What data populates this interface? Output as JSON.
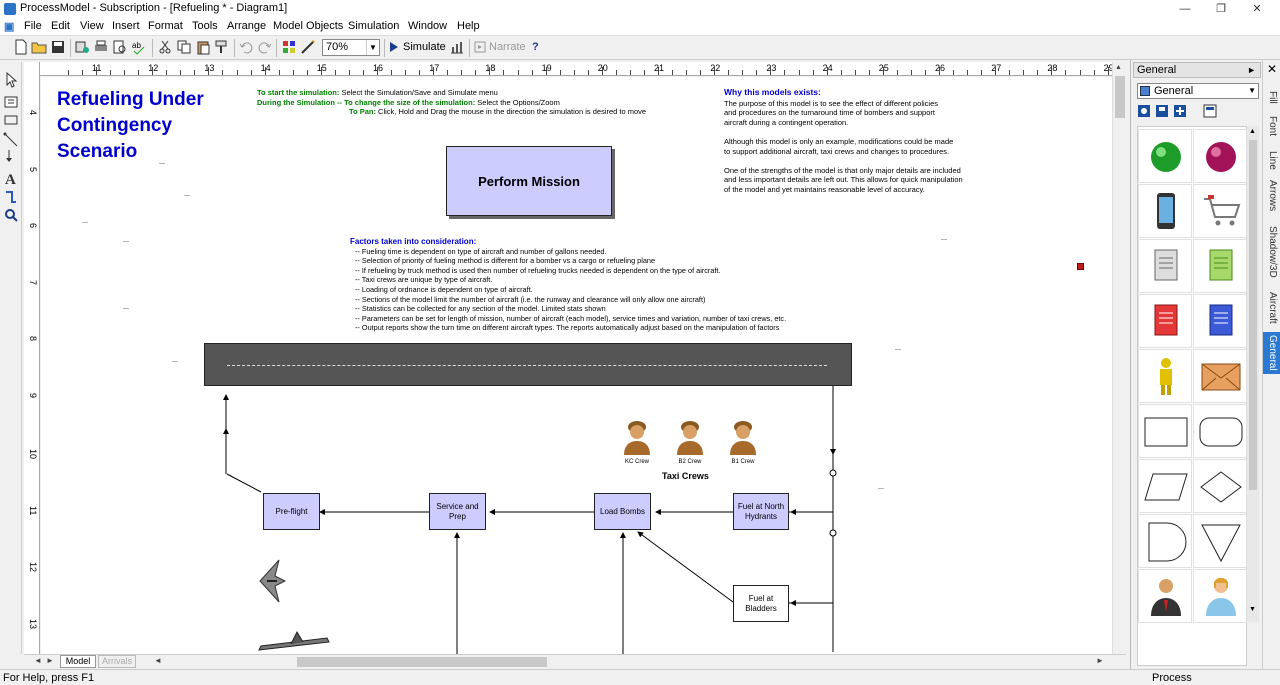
{
  "window": {
    "title": "ProcessModel - Subscription - [Refueling * - Diagram1]",
    "controls": [
      "—",
      "❐",
      "✕"
    ]
  },
  "menu": [
    "File",
    "Edit",
    "View",
    "Insert",
    "Format",
    "Tools",
    "Arrange",
    "Model Objects",
    "Simulation",
    "Window",
    "Help"
  ],
  "toolbar": {
    "zoom": "70%",
    "simulate_label": "Simulate",
    "narrate_label": "Narrate",
    "help_label": "?"
  },
  "ruler": {
    "h_unit": "in",
    "h_ticks": [
      "11",
      "12",
      "13",
      "14",
      "15",
      "16",
      "17",
      "18",
      "19",
      "20",
      "21",
      "22",
      "23",
      "24",
      "25",
      "26",
      "27",
      "28",
      "29"
    ],
    "v_ticks": [
      "4",
      "5",
      "6",
      "7",
      "8",
      "9",
      "10",
      "11",
      "12",
      "13"
    ]
  },
  "diagram": {
    "heading": [
      "Refueling Under",
      "Contingency",
      "Scenario"
    ],
    "instructions": [
      {
        "label": "To start the simulation:",
        "text": "Select the Simulation/Save and Simulate menu"
      },
      {
        "label": "During the Simulation -- To change the size of the simulation:",
        "text": "Select the Options/Zoom"
      },
      {
        "label": "To Pan:",
        "text": "Click, Hold  and Drag the mouse in the direction the simulation is desired to move"
      }
    ],
    "perform_mission": "Perform Mission",
    "why_title": "Why this models exists:",
    "why_lines": [
      "The purpose of this model is to see the effect of different policies",
      "and procedures on the turnaround time of bombers and support",
      "aircraft during a contingent operation.",
      "",
      "Although this model is only an example, modifications could be made",
      "to support additional aircraft, taxi crews and changes to procedures.",
      "",
      "One of the strengths of the model is that only major details are included",
      "and less important details are left out. This allows for quick manipulation",
      "of the model and yet maintains reasonable level of accuracy."
    ],
    "factors_title": "Factors taken into consideration:",
    "factors": [
      "-- Fueling time is dependent on type of aircraft and number of gallons needed.",
      "-- Selection of priority of fueling method is different for a bomber vs a cargo or refueling plane",
      "-- If refueling by truck method is used then number of refueling trucks needed is dependent on the type of aircraft.",
      "-- Taxi crews are unique by type of aircraft.",
      "-- Loading of ordnance is dependent on type of aircraft.",
      "-- Sections of the model limit the number of aircraft (i.e. the runway and clearance will only allow one aircraft)",
      "-- Statistics can be collected for any section of the model. Limited stats shown",
      "-- Parameters can be set for length of mission, number of aircraft (each model), service times and variation, number of taxi crews, etc.",
      "-- Output reports show the turn time on different aircraft types. The reports automatically adjust based on the manipulation of factors"
    ],
    "crews": [
      "KC Crew",
      "B2 Crew",
      "B1 Crew"
    ],
    "taxi_crews": "Taxi Crews",
    "boxes": {
      "preflight": "Pre-flight",
      "service": [
        "Service and",
        "Prep"
      ],
      "load_bombs": "Load Bombs",
      "fuel_north": [
        "Fuel at North",
        "Hydrants"
      ],
      "fuel_bladders": [
        "Fuel at",
        "Bladders"
      ]
    }
  },
  "sheet_tabs": {
    "model": "Model",
    "arrivals": "Arrivals"
  },
  "status": {
    "help": "For Help, press F1",
    "mode": "Process"
  },
  "panel": {
    "header": "General",
    "selected": "General",
    "shapes": [
      "green-ball",
      "magenta-ball",
      "phone",
      "cart",
      "gray-doc",
      "green-doc",
      "red-doc",
      "blue-doc",
      "person",
      "envelope",
      "rectangle",
      "rounded-rect",
      "parallelogram",
      "diamond",
      "delay",
      "triangle",
      "man",
      "woman"
    ]
  },
  "side_tabs": [
    "Fill",
    "Font",
    "Line",
    "Arrows",
    "Shadow/3D",
    "Aircraft",
    "General"
  ],
  "colors": {
    "heading_blue": "#0000cc",
    "instr_green": "#008000",
    "box_fill": "#ccccff",
    "runway": "#555555",
    "tab_active": "#2b79d0"
  }
}
